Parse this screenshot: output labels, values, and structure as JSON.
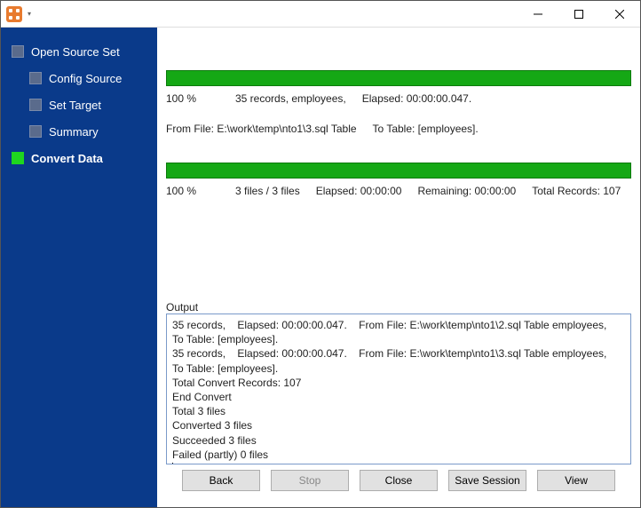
{
  "window": {
    "title": ""
  },
  "sidebar": {
    "items": [
      {
        "label": "Open Source Set",
        "sub": false,
        "active": false
      },
      {
        "label": "Config Source",
        "sub": true,
        "active": false
      },
      {
        "label": "Set Target",
        "sub": true,
        "active": false
      },
      {
        "label": "Summary",
        "sub": true,
        "active": false
      },
      {
        "label": "Convert Data",
        "sub": false,
        "active": true
      }
    ]
  },
  "progress1": {
    "percent": "100 %",
    "detail": "35 records, employees,",
    "elapsed": "Elapsed: 00:00:00.047.",
    "from": "From File: E:\\work\\temp\\nto1\\3.sql Table",
    "to": "To Table: [employees]."
  },
  "progress2": {
    "percent": "100 %",
    "files": "3 files / 3 files",
    "elapsed": "Elapsed: 00:00:00",
    "remaining": "Remaining: 00:00:00",
    "total": "Total Records: 107"
  },
  "output": {
    "label": "Output",
    "lines": [
      "35 records,    Elapsed: 00:00:00.047.    From File: E:\\work\\temp\\nto1\\2.sql Table employees,    To Table: [employees].",
      "35 records,    Elapsed: 00:00:00.047.    From File: E:\\work\\temp\\nto1\\3.sql Table employees,    To Table: [employees].",
      "Total Convert Records: 107",
      "End Convert",
      "Total 3 files",
      "Converted 3 files",
      "Succeeded 3 files",
      "Failed (partly) 0 files"
    ]
  },
  "buttons": {
    "back": "Back",
    "stop": "Stop",
    "close": "Close",
    "save_session": "Save Session",
    "view": "View"
  }
}
